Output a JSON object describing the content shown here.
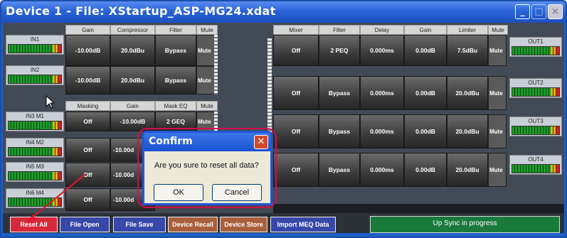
{
  "window": {
    "title": "Device 1  -  File: XStartup_ASP-MG24.xdat"
  },
  "input_section": {
    "headers": [
      "Gain",
      "Compressor",
      "Filter",
      "Mute"
    ],
    "rows": [
      {
        "label": "IN1",
        "gain": "-10.00dB",
        "comp": "20.0dBu",
        "filter": "Bypass",
        "mute": "Mute"
      },
      {
        "label": "IN2",
        "gain": "-10.00dB",
        "comp": "20.0dBu",
        "filter": "Bypass",
        "mute": "Mute"
      }
    ]
  },
  "mic_section": {
    "headers": [
      "Masking",
      "Gain",
      "Mask EQ",
      "Mute"
    ],
    "rows": [
      {
        "label": "IN3 M1",
        "masking": "Off",
        "gain": "-10.00dB",
        "eq": "2 GEQ",
        "mute": "Mute"
      },
      {
        "label": "IN4 M2",
        "masking": "Off",
        "gain": "-10.00d"
      },
      {
        "label": "IN5 M3",
        "masking": "Off",
        "gain": "-10.00d"
      },
      {
        "label": "IN6 M4",
        "masking": "Off",
        "gain": "-10.00d"
      }
    ]
  },
  "output_section": {
    "headers": [
      "Mixer",
      "Filter",
      "Delay",
      "Gain",
      "Limiter",
      "Mute"
    ],
    "rows": [
      {
        "label": "OUT1",
        "mixer": "Off",
        "filter": "2 PEQ",
        "delay": "0.000ms",
        "gain": "0.00dB",
        "limiter": "7.5dBu",
        "mute": "Mute"
      },
      {
        "label": "OUT2",
        "mixer": "Off",
        "filter": "Bypass",
        "delay": "0.000ms",
        "gain": "0.00dB",
        "limiter": "20.0dBu",
        "mute": "Mute"
      },
      {
        "label": "OUT3",
        "mixer": "Off",
        "filter": "Bypass",
        "delay": "0.000ms",
        "gain": "0.00dB",
        "limiter": "20.0dBu",
        "mute": "Mute"
      },
      {
        "label": "OUT4",
        "mixer": "Off",
        "filter": "Bypass",
        "delay": "0.000ms",
        "gain": "0.00dB",
        "limiter": "20.0dBu",
        "mute": "Mute"
      }
    ]
  },
  "bottom_bar": {
    "reset_all": "Reset All",
    "file_open": "File Open",
    "file_save": "File Save",
    "device_recall": "Device Recall",
    "device_store": "Device Store",
    "import_meq": "Import MEQ Data",
    "status": "Up Sync in progress"
  },
  "dialog": {
    "title": "Confirm",
    "message": "Are you sure to reset all data?",
    "ok": "OK",
    "cancel": "Cancel"
  },
  "colors": {
    "titlebar": "#2a63d8",
    "reset": "#d8283a",
    "blue_btn": "#3848a8",
    "brown_btn": "#a85f3c",
    "status": "#1a7a3c"
  }
}
